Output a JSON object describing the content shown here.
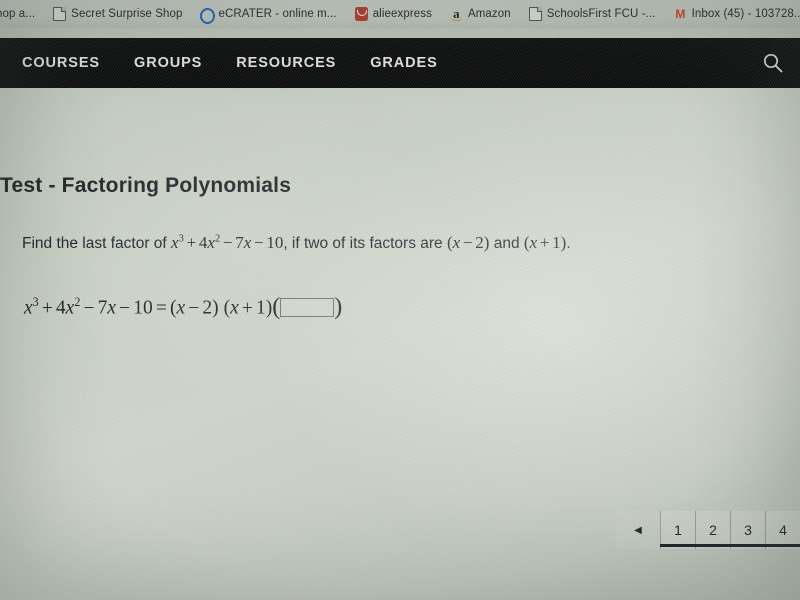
{
  "browser": {
    "bookmarks": [
      {
        "label": "hop a...",
        "icon": "none-icon",
        "cutoff": true
      },
      {
        "label": "Secret Surprise Shop",
        "icon": "page-icon"
      },
      {
        "label": "eCRATER - online m...",
        "icon": "ecrater-ring-icon"
      },
      {
        "label": "alieexpress",
        "icon": "aliexpress-icon"
      },
      {
        "label": "Amazon",
        "icon": "amazon-a-icon"
      },
      {
        "label": "SchoolsFirst FCU -...",
        "icon": "page-icon"
      },
      {
        "label": "Inbox (45) - 103728...",
        "icon": "gmail-m-icon"
      },
      {
        "label": "",
        "icon": "blue-cut-icon",
        "cutoff": true
      }
    ]
  },
  "nav": {
    "items": [
      {
        "label": "COURSES"
      },
      {
        "label": "GROUPS"
      },
      {
        "label": "RESOURCES"
      },
      {
        "label": "GRADES"
      }
    ],
    "search_icon": "search-icon",
    "background_color": "#0b0b0d",
    "text_color": "#e7e7e5"
  },
  "page": {
    "title": "Test - Factoring Polynomials",
    "question": {
      "prefix": "Find the last factor of ",
      "polynomial": {
        "x_cubed": "x",
        "exp3": "3",
        "plus": "+",
        "coef4": "4",
        "x2": "x",
        "exp2": "2",
        "minus1": "−",
        "coef7": "7",
        "x1": "x",
        "minus2": "−",
        "const10": "10"
      },
      "middle": ", if two of its factors are ",
      "factor1": {
        "open": "(",
        "var": "x",
        "op": "−",
        "num": "2",
        "close": ")"
      },
      "conjunction": " and ",
      "factor2": {
        "open": "(",
        "var": "x",
        "op": "+",
        "num": "1",
        "close": ")"
      },
      "suffix": "."
    },
    "equation": {
      "lhs": {
        "x_cubed": "x",
        "exp3": "3",
        "plus": "+",
        "coef4": "4",
        "x2": "x",
        "exp2": "2",
        "minus1": "−",
        "coef7": "7",
        "x1": "x",
        "minus2": "−",
        "const10": "10"
      },
      "equals": "=",
      "factor1": {
        "open": "(",
        "var": "x",
        "op": "−",
        "num": "2",
        "close": ")"
      },
      "factor2": {
        "open": "(",
        "var": "x",
        "op": "+",
        "num": "1",
        "close": ")"
      },
      "answer_open_paren": "(",
      "answer_close_paren": ")",
      "answer_value": "",
      "answer_placeholder": ""
    }
  },
  "pagination": {
    "prev_icon": "triangle-left-icon",
    "pages": [
      {
        "label": "1",
        "active": true
      },
      {
        "label": "2",
        "active": false
      },
      {
        "label": "3",
        "active": false
      },
      {
        "label": "4",
        "active": false
      }
    ]
  },
  "colors": {
    "screen_background": "#cfd5cb",
    "nav_background": "#0b0b0d",
    "text_primary": "#1d2025",
    "active_underline": "#1b1e22"
  }
}
